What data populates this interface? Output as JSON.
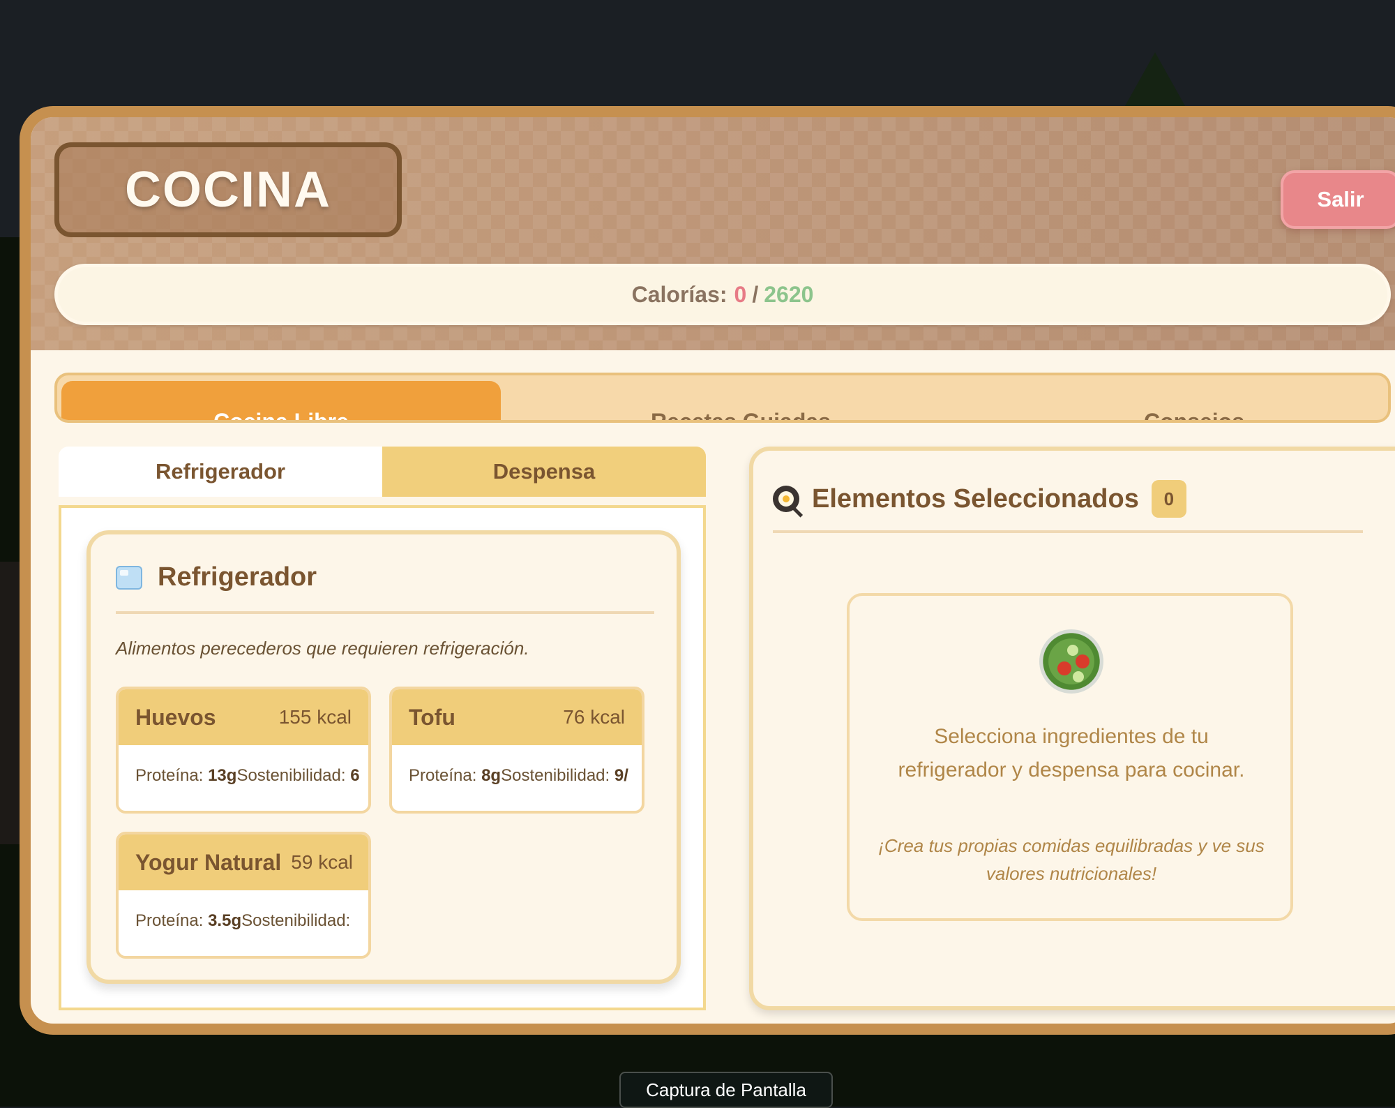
{
  "header": {
    "title": "COCINA",
    "exit_label": "Salir",
    "calories": {
      "label": "Calorías:",
      "current": "0",
      "separator": "/",
      "goal": "2620"
    }
  },
  "mode_tabs": [
    {
      "label": "Cocina Libre",
      "active": true
    },
    {
      "label": "Recetas Guiadas",
      "active": false
    },
    {
      "label": "Consejos",
      "active": false
    }
  ],
  "storage_tabs": [
    {
      "label": "Refrigerador",
      "active": true
    },
    {
      "label": "Despensa",
      "active": false
    }
  ],
  "fridge": {
    "icon": "ice-cube-icon",
    "title": "Refrigerador",
    "description": "Alimentos perecederos que requieren refrigeración.",
    "items": [
      {
        "name": "Huevos",
        "kcal": "155 kcal",
        "protein_label": "Proteína:",
        "protein": "13g",
        "sustain_label": "Sostenibilidad:",
        "sustain": "6"
      },
      {
        "name": "Tofu",
        "kcal": "76 kcal",
        "protein_label": "Proteína:",
        "protein": "8g",
        "sustain_label": "Sostenibilidad:",
        "sustain": "9/"
      },
      {
        "name": "Yogur Natural",
        "kcal": "59 kcal",
        "protein_label": "Proteína:",
        "protein": "3.5g",
        "sustain_label": "Sostenibilidad:",
        "sustain": ""
      }
    ]
  },
  "selected": {
    "icon": "frying-pan-icon",
    "title": "Elementos Seleccionados",
    "count": "0",
    "empty_icon": "salad-icon",
    "empty_message": "Selecciona ingredientes de tu refrigerador y despensa para cocinar.",
    "empty_hint": "¡Crea tus propias comidas equilibradas y ve sus valores nutricionales!"
  },
  "tooltip": "Captura de Pantalla",
  "colors": {
    "frame": "#c6904f",
    "accent_tab": "#f0a03c",
    "card_header": "#f0cd7a",
    "calories_current": "#e77b86",
    "calories_goal": "#8cc48c",
    "exit_button": "#e8878a"
  }
}
